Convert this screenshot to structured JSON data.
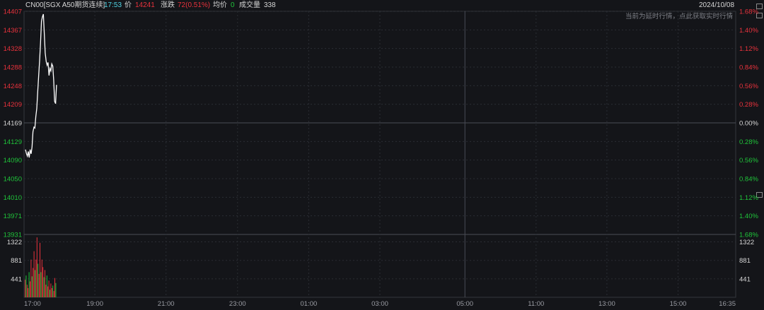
{
  "header": {
    "symbol": "CN00[SGX A50期货连续]",
    "time": "17:53",
    "price_label": "价",
    "price_value": "14241",
    "change_label": "涨跌",
    "change_value": "72(0.51%)",
    "avg_label": "均价",
    "avg_value": "0",
    "volume_label": "成交量",
    "volume_value": "338",
    "date": "2024/10/08"
  },
  "notice": "当前为延时行情，点此获取实时行情",
  "colors": {
    "up": "#e8323c",
    "down": "#1fc43a",
    "flat": "#d6d6d6",
    "line": "#ffffff",
    "grid": "#2a2d33",
    "bg": "#141519"
  },
  "chart_data": [
    {
      "type": "line",
      "reference_price": 14169,
      "y_ticks_left": [
        "14407",
        "14367",
        "14328",
        "14288",
        "14248",
        "14209",
        "14169",
        "14129",
        "14090",
        "14050",
        "14010",
        "13971",
        "13931"
      ],
      "y_ticks_right": [
        "1.68%",
        "1.40%",
        "1.12%",
        "0.84%",
        "0.56%",
        "0.28%",
        "0.00%",
        "0.28%",
        "0.56%",
        "0.84%",
        "1.12%",
        "1.40%",
        "1.68%"
      ],
      "x_ticks": [
        "17:00",
        "19:00",
        "21:00",
        "23:00",
        "01:00",
        "03:00",
        "05:00",
        "11:00",
        "13:00",
        "15:00",
        "16:35"
      ],
      "series": [
        {
          "values": [
            14112,
            14104,
            14098,
            14108,
            14095,
            14112,
            14103,
            14118,
            14150,
            14160,
            14158,
            14182,
            14200,
            14235,
            14268,
            14302,
            14340,
            14385,
            14395,
            14401,
            14360,
            14318,
            14300,
            14292,
            14298,
            14270,
            14285,
            14280,
            14295,
            14290,
            14260,
            14215,
            14210,
            14250
          ]
        }
      ]
    },
    {
      "type": "bar",
      "y_ticks_left": [
        "1322",
        "881",
        "441"
      ],
      "y_ticks_right": [
        "1322",
        "881",
        "441"
      ],
      "values": [
        420,
        520,
        300,
        220,
        600,
        380,
        900,
        500,
        700,
        1100,
        650,
        900,
        1430,
        800,
        560,
        1300,
        600,
        900,
        720,
        480,
        650,
        300,
        520,
        260,
        400,
        180,
        330,
        220,
        280,
        150,
        460,
        340
      ]
    }
  ]
}
